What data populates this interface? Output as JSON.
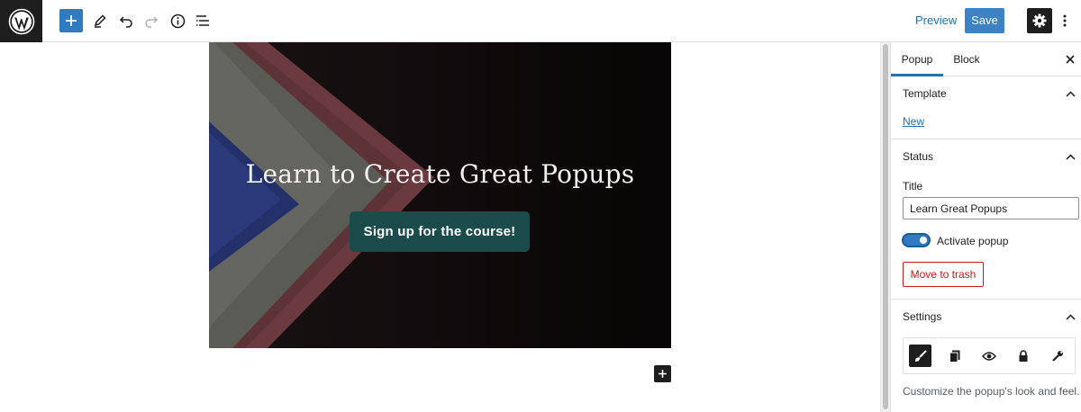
{
  "toolbar": {
    "logo": "wordpress-logo",
    "add_block": "plus-icon",
    "tools": "pencil-icon",
    "undo": "undo-icon",
    "redo": "redo-icon",
    "details": "info-icon",
    "outline": "list-view-icon",
    "preview_label": "Preview",
    "save_label": "Save",
    "settings": "gear-icon",
    "more": "more-vertical-icon"
  },
  "canvas": {
    "cover_title": "Learn to Create Great Popups",
    "cover_button": "Sign up for the course!",
    "inserter": "plus-icon"
  },
  "sidebar": {
    "tabs": [
      {
        "label": "Popup",
        "active": true
      },
      {
        "label": "Block",
        "active": false
      }
    ],
    "close": "close-icon",
    "template": {
      "heading": "Template",
      "link": "New"
    },
    "status": {
      "heading": "Status",
      "title_label": "Title",
      "title_value": "Learn Great Popups",
      "toggle_label": "Activate popup",
      "toggle_on": true,
      "trash_label": "Move to trash"
    },
    "settings": {
      "heading": "Settings",
      "icons": [
        "brush-icon",
        "copy-icon",
        "eye-icon",
        "lock-icon",
        "wrench-icon"
      ],
      "active_icon": "brush-icon",
      "description": "Customize the popup's look and feel."
    }
  },
  "colors": {
    "accent": "#2271b1",
    "save": "#3d82c4",
    "danger": "#cc1818",
    "cover_button": "#1c4b4b"
  }
}
